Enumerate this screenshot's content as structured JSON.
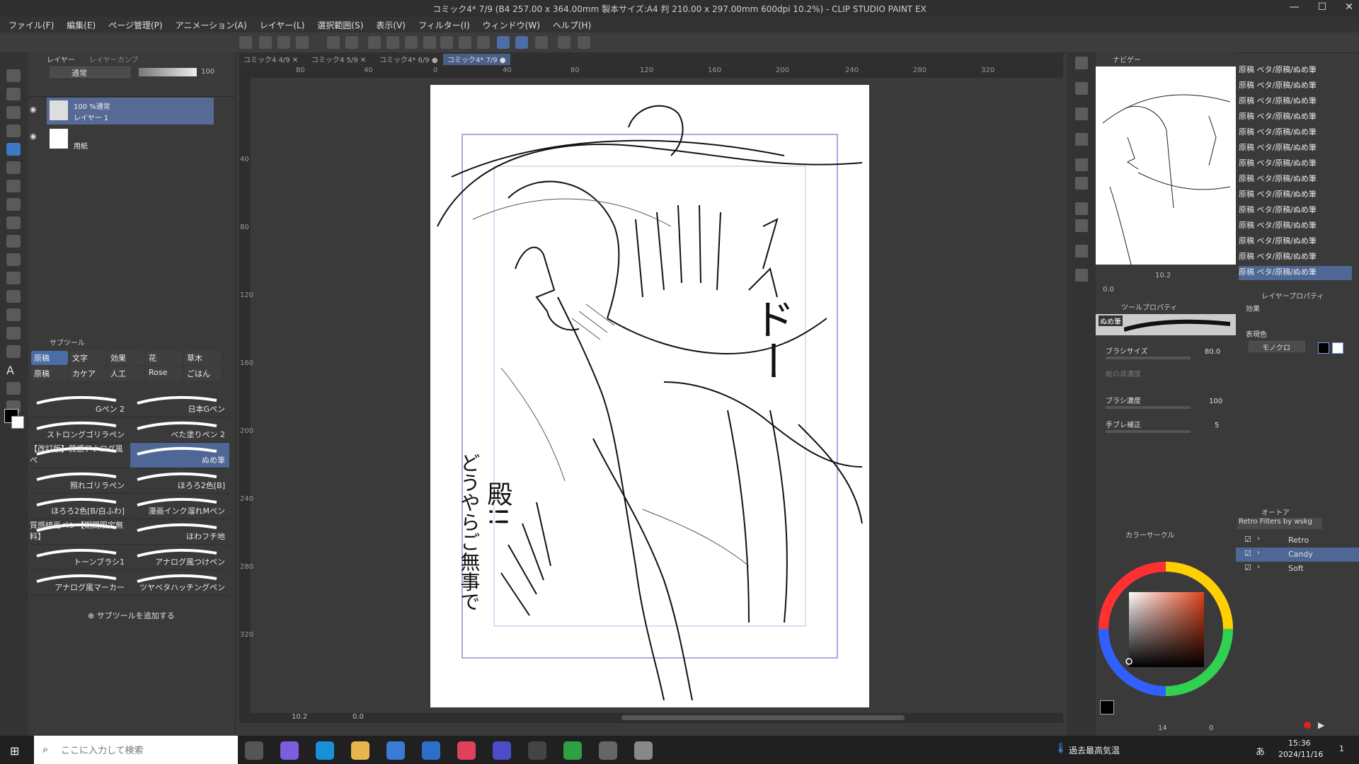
{
  "window": {
    "title": "コミック4* 7/9 (B4 257.00 x 364.00mm 製本サイズ:A4 判 210.00 x 297.00mm 600dpi 10.2%) - CLIP STUDIO PAINT EX",
    "minimize": "—",
    "maximize": "☐",
    "close": "✕"
  },
  "menu": [
    "ファイル(F)",
    "編集(E)",
    "ページ管理(P)",
    "アニメーション(A)",
    "レイヤー(L)",
    "選択範囲(S)",
    "表示(V)",
    "フィルター(I)",
    "ウィンドウ(W)",
    "ヘルプ(H)"
  ],
  "layer_panel": {
    "tab1": "レイヤー",
    "tab2": "レイヤーカンプ",
    "blend_mode": "通常",
    "opacity": "100",
    "layers": [
      {
        "meta": "100 %通常",
        "name": "レイヤー 1"
      },
      {
        "meta": "",
        "name": "用紙"
      }
    ]
  },
  "subtool_panel": {
    "tab": "サブツール",
    "categories_row1": [
      "原稿",
      "文字",
      "効果",
      "花",
      "草木"
    ],
    "categories_row2": [
      "原稿",
      "カケア",
      "人工",
      "Rose",
      "ごはん"
    ],
    "brushes": [
      "Gペン 2",
      "日本Gペン",
      "ストロングゴリラペン",
      "べた塗りペン 2",
      "【改訂版】質感アナログ風ペ",
      "ぬめ筆",
      "照れゴリラペン",
      "ほろろ2色[B]",
      "ほろろ2色[B/白ふわ]",
      "漫画インク溜れMペン",
      "質感線画ペン【期間限定無料】",
      "ほわフチ地",
      "トーンブラシ1",
      "アナログ風つけペン",
      "アナログ風マーカー",
      "ツヤベタハッチングペン"
    ],
    "add_label": "サブツールを追加する"
  },
  "doc_tabs": [
    {
      "label": "コミック4",
      "page": "4/9"
    },
    {
      "label": "コミック4",
      "page": "5/9"
    },
    {
      "label": "コミック4*",
      "page": "6/9"
    },
    {
      "label": "コミック4*",
      "page": "7/9"
    }
  ],
  "rulers": {
    "top": [
      "80",
      "40",
      "0",
      "40",
      "80",
      "120",
      "160",
      "200",
      "240",
      "280",
      "320"
    ],
    "left": [
      "40",
      "80",
      "120",
      "160",
      "200",
      "240",
      "280",
      "320"
    ]
  },
  "canvas": {
    "lettering_vertical": "殿!!",
    "lettering_vertical2": "どうやらご無事で",
    "sfx": "ドー"
  },
  "statusbar": {
    "zoom": "10.2",
    "angle": "0.0"
  },
  "navigator": {
    "tab": "ナビゲー",
    "zoom": "10.2",
    "angle": "0.0"
  },
  "tool_property": {
    "tab": "ツールプロパティ",
    "brush_name": "ぬめ筆",
    "brush_size_label": "ブラシサイズ",
    "brush_size": "80.0",
    "ink_density_label": "絵の具濃度",
    "brush_density_label": "ブラシ濃度",
    "brush_density": "100",
    "stabilization_label": "手ブレ補正",
    "stabilization": "5"
  },
  "color_circle": {
    "tab": "カラーサークル",
    "footer_value1": "14",
    "footer_value2": "0"
  },
  "history": {
    "items": [
      "原稿  ベタ/原稿/ぬめ筆",
      "原稿  ベタ/原稿/ぬめ筆",
      "原稿  ベタ/原稿/ぬめ筆",
      "原稿  ベタ/原稿/ぬめ筆",
      "原稿  ベタ/原稿/ぬめ筆",
      "原稿  ベタ/原稿/ぬめ筆",
      "原稿  ベタ/原稿/ぬめ筆",
      "原稿  ベタ/原稿/ぬめ筆",
      "原稿  ベタ/原稿/ぬめ筆",
      "原稿  ベタ/原稿/ぬめ筆",
      "原稿  ベタ/原稿/ぬめ筆",
      "原稿  ベタ/原稿/ぬめ筆",
      "原稿  ベタ/原稿/ぬめ筆",
      "原稿  ベタ/原稿/ぬめ筆"
    ]
  },
  "layer_property": {
    "tab": "レイヤープロパティ",
    "effect_label": "効果",
    "expression_color_label": "表現色",
    "expression_color": "モノクロ"
  },
  "auto_action": {
    "tab": "オートア",
    "set": "Retro Filters by wskg",
    "items": [
      "Retro",
      "Candy",
      "Soft"
    ]
  },
  "taskbar": {
    "search_placeholder": "ここに入力して検索",
    "weather": "過去最高気温",
    "time": "15:36",
    "date": "2024/11/16",
    "ime": "あ",
    "notif": "1"
  },
  "colors": {
    "accent_selected": "#4e6794",
    "tool_selected": "#3d78c4",
    "canvas_bg": "#3a3a3a",
    "paper": "#ffffff",
    "frame_line": "#8a8fd6"
  }
}
